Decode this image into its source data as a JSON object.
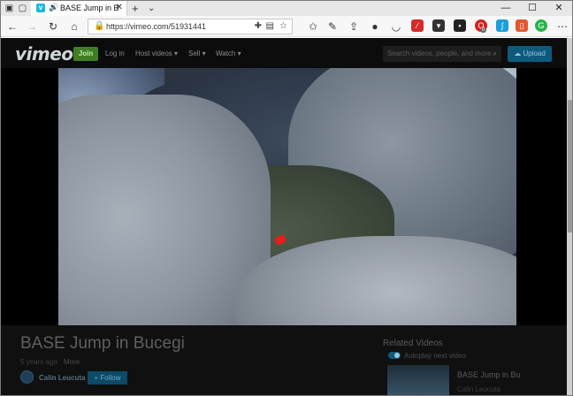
{
  "browser": {
    "tab_title": "BASE Jump in Bucegi",
    "url": "https://vimeo.com/51931441",
    "new_tab": "+",
    "tab_menu": "⌄",
    "tab_close": "✕",
    "window_controls": {
      "minimize": "—",
      "maximize": "☐",
      "close": "✕"
    },
    "extension_badge": "0"
  },
  "header": {
    "logo": "vimeo",
    "join": "Join",
    "login": "Log in",
    "host_videos": "Host videos ▾",
    "sell": "Sell ▾",
    "watch": "Watch ▾",
    "search_placeholder": "Search videos, people, and more",
    "upload": "Upload"
  },
  "video": {
    "title": "BASE Jump in Bucegi",
    "age": "5 years ago",
    "more": "More",
    "author": "Calin Leucuta",
    "follow": "+ Follow"
  },
  "related": {
    "heading": "Related Videos",
    "autoplay": "Autoplay next video",
    "items": [
      {
        "title": "BASE Jump in Bu...",
        "author": "Calin Leucuta"
      }
    ]
  },
  "colors": {
    "accent": "#1ab7ea",
    "join_green": "#3f7f24",
    "upload_blue": "#0d5a7c",
    "parachute": "#e51d1d"
  }
}
